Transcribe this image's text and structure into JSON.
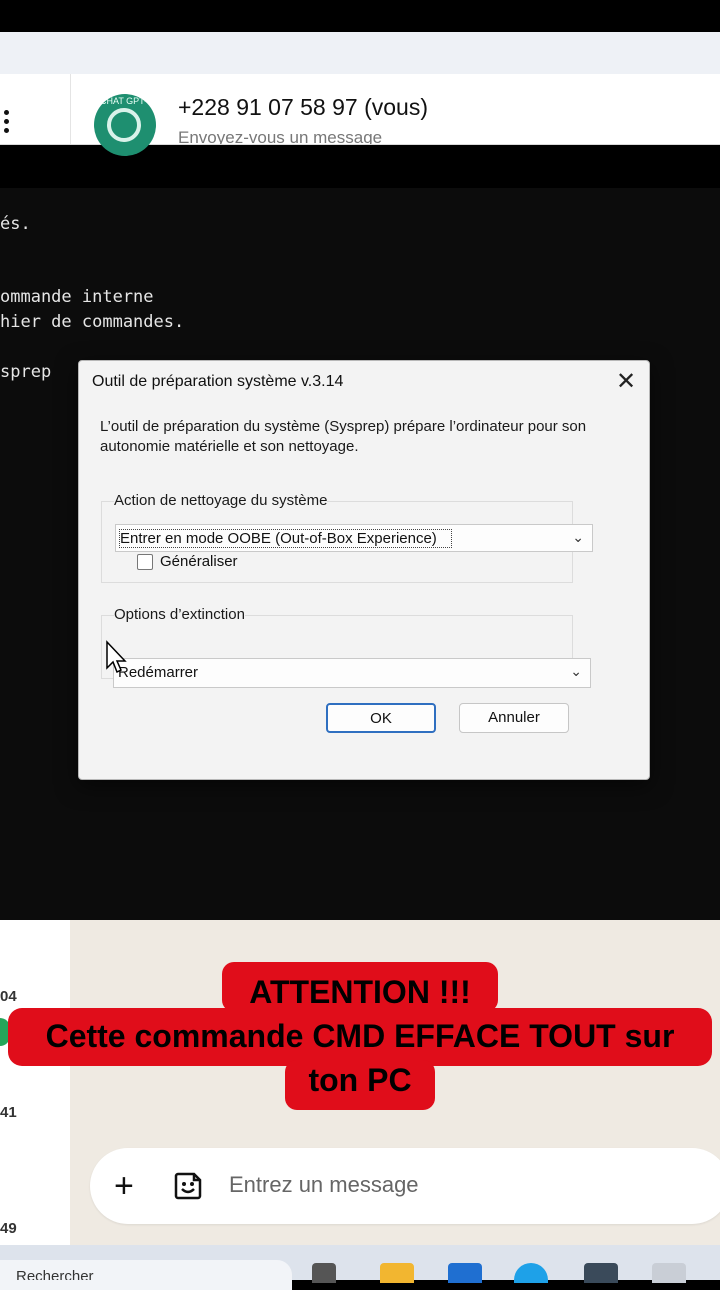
{
  "header": {
    "contact_name": "+228 91 07 58 97 (vous)",
    "contact_subtitle": "Envoyez-vous un message",
    "avatar_label": "CHAT GPT-5"
  },
  "terminal": {
    "lines": [
      "és.",
      "ommande interne",
      "hier de commandes.",
      "sprep"
    ]
  },
  "dialog": {
    "title": "Outil de préparation système v.3.14",
    "close_glyph": "✕",
    "description": "L’outil de préparation du système (Sysprep) prépare l’ordinateur pour son autonomie matérielle et son nettoyage.",
    "cleanup_group_label": "Action de nettoyage du système",
    "cleanup_value": "Entrer en mode OOBE (Out-of-Box Experience)",
    "generalize_label": "Généraliser",
    "generalize_checked": false,
    "shutdown_group_label": "Options d’extinction",
    "shutdown_value": "Redémarrer",
    "ok_label": "OK",
    "cancel_label": "Annuler"
  },
  "chat_list_times": [
    "04",
    "41",
    "49"
  ],
  "warning": {
    "line1": "ATTENTION !!!",
    "line2": "Cette commande CMD EFFACE TOUT sur",
    "line3": "ton PC",
    "color": "#e00d1a"
  },
  "composer": {
    "plus_glyph": "+",
    "placeholder": "Entrez un message"
  },
  "taskbar": {
    "search_text": "Rechercher"
  }
}
